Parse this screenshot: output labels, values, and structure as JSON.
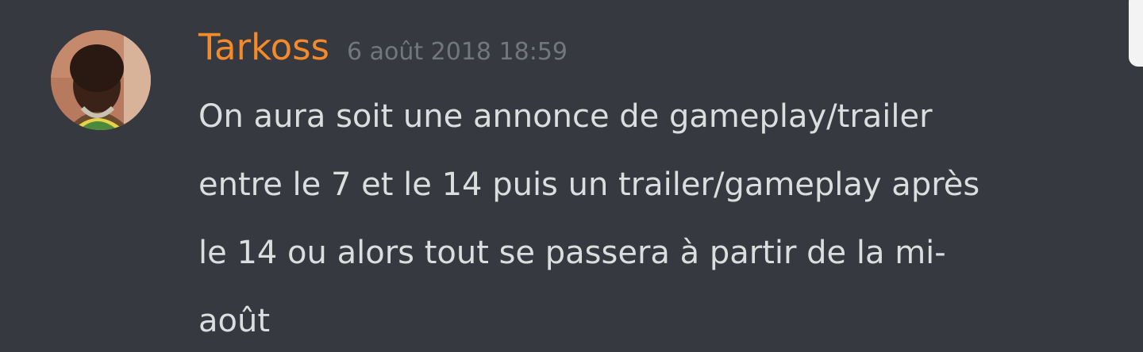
{
  "message": {
    "author": "Tarkoss",
    "timestamp": "6 août 2018 18:59",
    "lines": [
      "On aura soit une annonce de gameplay/trailer",
      "entre le 7 et le 14 puis un trailer/gameplay après",
      "le 14 ou alors tout se passera à partir de la mi-",
      "août"
    ]
  },
  "colors": {
    "background": "#36393f",
    "author": "#f48a2a",
    "timestamp": "#72767d",
    "text": "#dcddde"
  }
}
